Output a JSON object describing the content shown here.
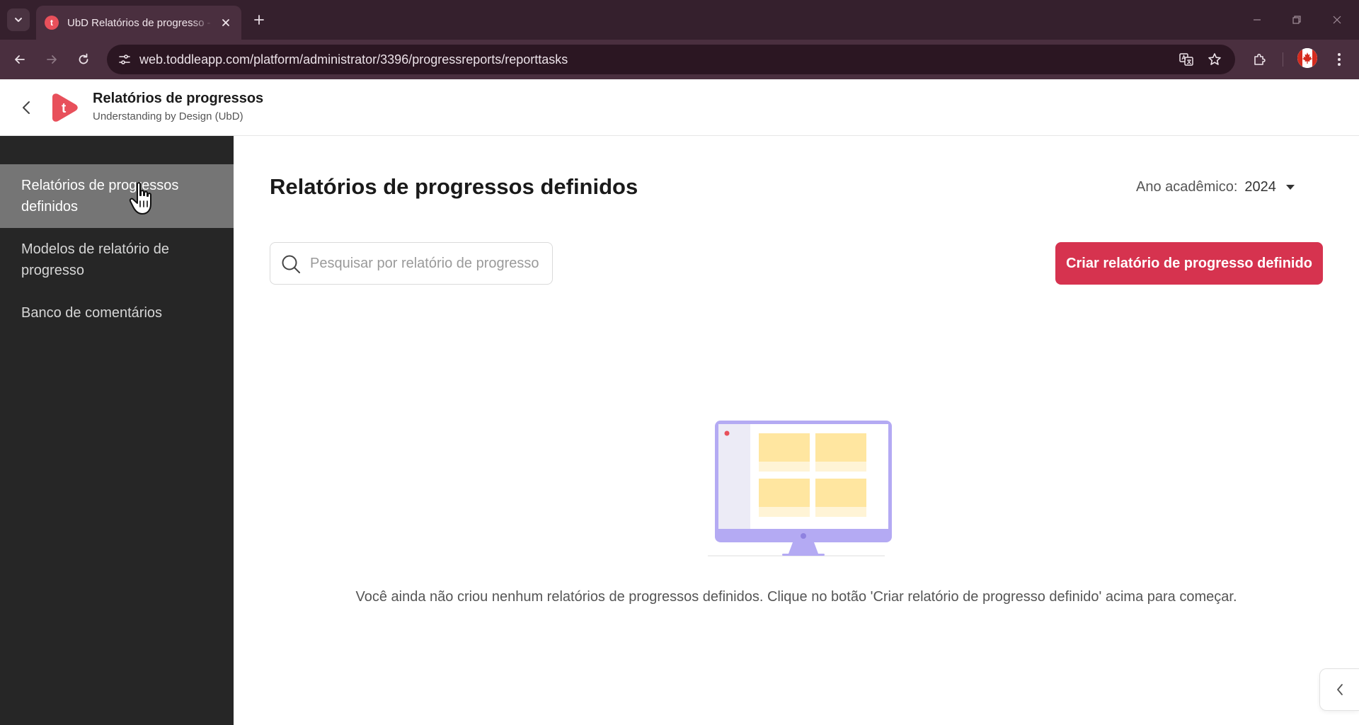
{
  "browser": {
    "tab_title": "UbD Relatórios de progresso - Toddle",
    "tab_favicon_letter": "t",
    "url": "web.toddleapp.com/platform/administrator/3396/progressreports/reporttasks"
  },
  "header": {
    "logo_letter": "t",
    "title": "Relatórios de progressos",
    "subtitle": "Understanding by Design (UbD)"
  },
  "sidebar": {
    "items": [
      {
        "label": "Relatórios de progressos definidos",
        "active": true
      },
      {
        "label": "Modelos de relatório de progresso",
        "active": false
      },
      {
        "label": "Banco de comentários",
        "active": false
      }
    ]
  },
  "main": {
    "title": "Relatórios de progressos definidos",
    "academic_year_label": "Ano acadêmico:",
    "academic_year_value": "2024",
    "search_placeholder": "Pesquisar por relatório de progresso",
    "search_value": "",
    "create_button_label": "Criar relatório de progresso definido",
    "empty_message": "Você ainda não criou nenhum relatórios de progressos definidos. Clique no botão 'Criar relatório de progresso definido' acima para começar."
  },
  "colors": {
    "brand": "#e8505b",
    "primary_button": "#d6334f",
    "sidebar_bg": "#262626",
    "sidebar_active": "#757575",
    "browser_frame": "#35202d"
  }
}
